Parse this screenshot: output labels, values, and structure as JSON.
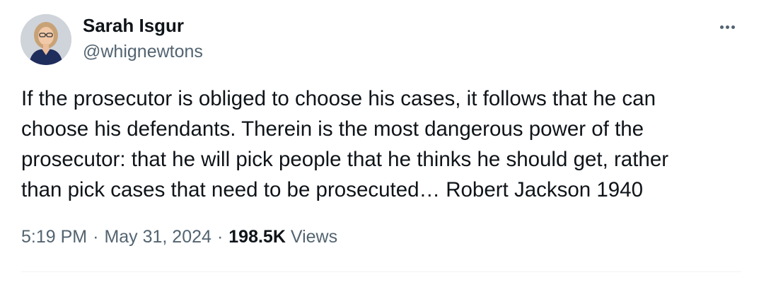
{
  "author": {
    "display_name": "Sarah Isgur",
    "handle": "@whignewtons"
  },
  "tweet": {
    "text": "If the prosecutor is obliged to choose his cases, it follows that he can\nchoose his defendants. Therein is the most dangerous power of the\nprosecutor: that he will pick people that he thinks he should get, rather\nthan pick cases that need to be prosecuted… Robert Jackson 1940",
    "time": "5:19 PM",
    "date": "May 31, 2024",
    "separator": "·",
    "views_count": "198.5K",
    "views_label": "Views"
  },
  "icons": {
    "more": "more-horizontal-icon",
    "avatar": "profile-photo"
  },
  "colors": {
    "text_primary": "#0f1419",
    "text_secondary": "#536471",
    "divider": "#eff3f4"
  }
}
